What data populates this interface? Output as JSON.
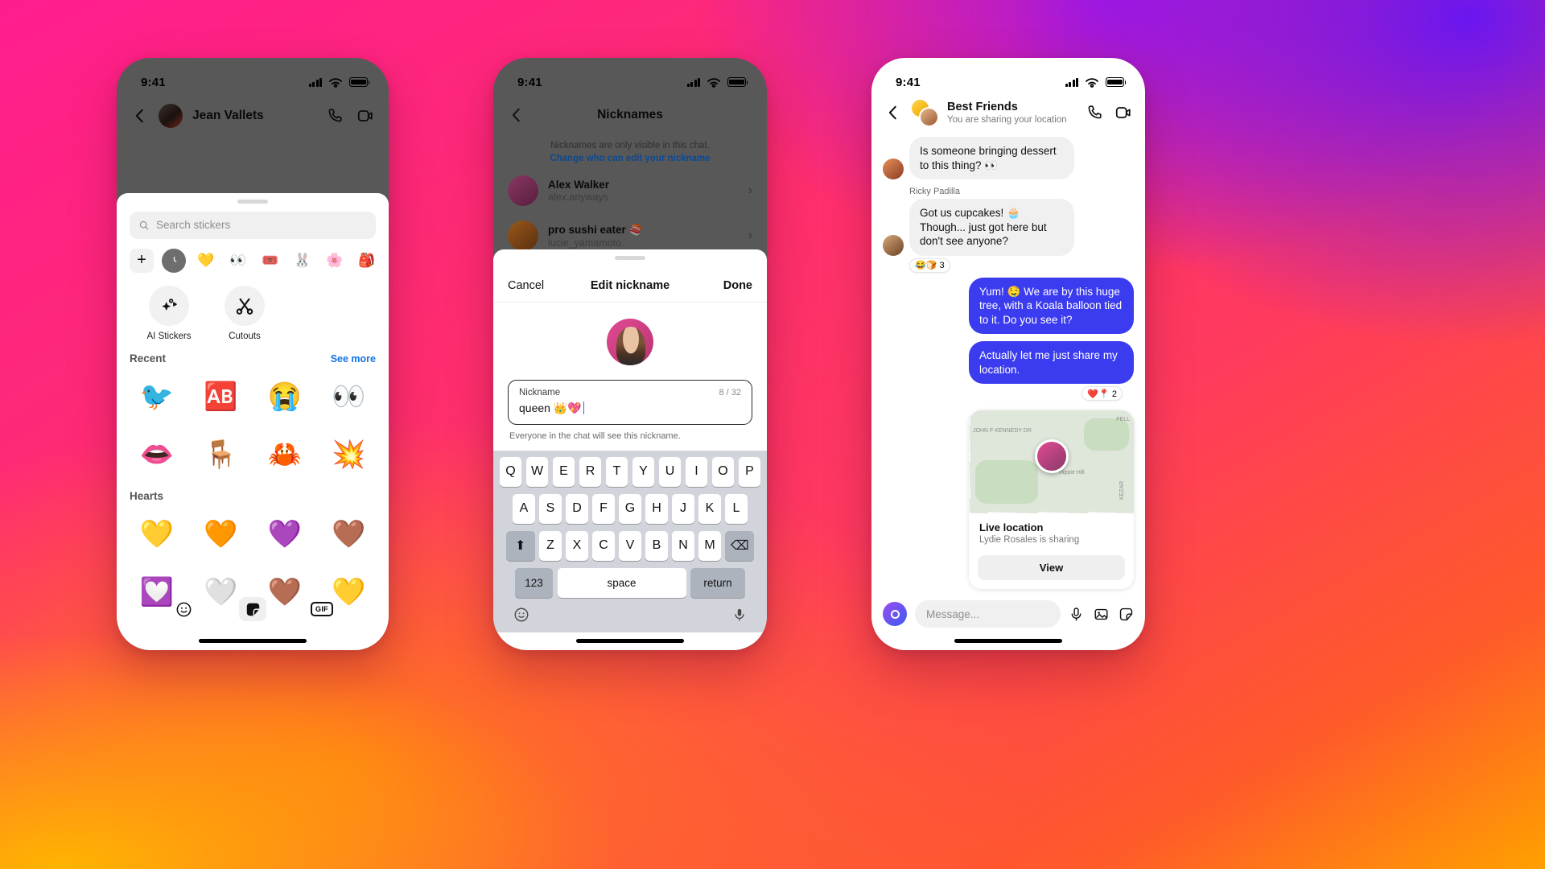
{
  "phone1": {
    "status": {
      "time": "9:41"
    },
    "header": {
      "contact_name": "Jean Vallets",
      "back_icon": "chevron-left-icon",
      "call_icon": "phone-icon",
      "video_icon": "video-camera-icon"
    },
    "search": {
      "placeholder": "Search stickers",
      "icon": "search-icon"
    },
    "packs": [
      {
        "name": "add-pack",
        "glyph": "+"
      },
      {
        "name": "recent-pack",
        "glyph": "🕐"
      },
      {
        "name": "heart-face-pack",
        "glyph": "💛"
      },
      {
        "name": "eyes-pack",
        "glyph": "👀"
      },
      {
        "name": "text-pack",
        "glyph": "🎟️"
      },
      {
        "name": "bunny-pack",
        "glyph": "🐰"
      },
      {
        "name": "flower-pack",
        "glyph": "🌸"
      },
      {
        "name": "bag-pack",
        "glyph": "🎒"
      }
    ],
    "shortcuts": [
      {
        "label": "AI Stickers",
        "icon": "sparkle-icon"
      },
      {
        "label": "Cutouts",
        "icon": "scissors-icon"
      }
    ],
    "recent": {
      "title": "Recent",
      "see_more": "See more",
      "stickers": [
        "🐦",
        "🆎",
        "😭",
        "👀",
        "👄",
        "🪑",
        "🦀",
        "💥"
      ]
    },
    "hearts": {
      "title": "Hearts",
      "stickers": [
        "💛",
        "🧡",
        "💜",
        "🤎",
        "💟",
        "🤍",
        "🤎",
        "💛"
      ]
    },
    "tabs": [
      {
        "name": "emoji-tab",
        "icon": "emoji-face-icon",
        "selected": false
      },
      {
        "name": "stickers-tab",
        "icon": "sticker-icon",
        "selected": true
      },
      {
        "name": "gif-tab",
        "icon": "gif-icon",
        "label": "GIF",
        "selected": false
      }
    ]
  },
  "phone2": {
    "status": {
      "time": "9:41"
    },
    "header": {
      "title": "Nicknames",
      "back_icon": "chevron-left-icon"
    },
    "note": {
      "line1": "Nicknames are only visible in this chat.",
      "link": "Change who can edit your nickname"
    },
    "people": [
      {
        "name": "Alex Walker",
        "handle": "alex.anyways"
      },
      {
        "name": "pro sushi eater 🍣",
        "handle": "lucie_yamamoto"
      }
    ],
    "modal": {
      "cancel": "Cancel",
      "title": "Edit nickname",
      "done": "Done",
      "field_label": "Nickname",
      "field_value": "queen 👑💖",
      "counter": "8 / 32",
      "helper": "Everyone in the chat will see this nickname."
    },
    "keyboard": {
      "row1": [
        "Q",
        "W",
        "E",
        "R",
        "T",
        "Y",
        "U",
        "I",
        "O",
        "P"
      ],
      "row2": [
        "A",
        "S",
        "D",
        "F",
        "G",
        "H",
        "J",
        "K",
        "L"
      ],
      "row3": [
        "Z",
        "X",
        "C",
        "V",
        "B",
        "N",
        "M"
      ],
      "shift": "⬆",
      "backspace": "⌫",
      "numeric": "123",
      "space": "space",
      "return": "return",
      "emoji_icon": "emoji-face-icon",
      "mic_icon": "microphone-icon"
    }
  },
  "phone3": {
    "status": {
      "time": "9:41"
    },
    "header": {
      "title": "Best Friends",
      "subtitle": "You are sharing your location",
      "back_icon": "chevron-left-icon",
      "call_icon": "phone-icon",
      "video_icon": "video-camera-icon"
    },
    "messages": [
      {
        "type": "in",
        "text": "Is someone bringing dessert to this thing? 👀"
      },
      {
        "type": "sender",
        "text": "Ricky Padilla"
      },
      {
        "type": "in",
        "text": "Got us cupcakes! 🧁 Though... just got here but don't see anyone?",
        "reactions": "😂🍞 3"
      },
      {
        "type": "out",
        "text": "Yum! 🤤 We are by this huge tree, with a Koala balloon tied to it. Do you see it?"
      },
      {
        "type": "out",
        "text": "Actually let me just share my location.",
        "reactions": "❤️📍 2"
      }
    ],
    "location": {
      "title": "Live location",
      "subtitle": "Lydie Rosales is sharing",
      "button": "View",
      "map_labels": [
        "JOHN F KENNEDY DR",
        "Hippie Hill",
        "FELL",
        "KEZAR"
      ]
    },
    "composer": {
      "placeholder": "Message...",
      "camera_icon": "camera-icon",
      "mic_icon": "microphone-icon",
      "image_icon": "image-icon",
      "sticker_icon": "sticker-icon"
    }
  }
}
